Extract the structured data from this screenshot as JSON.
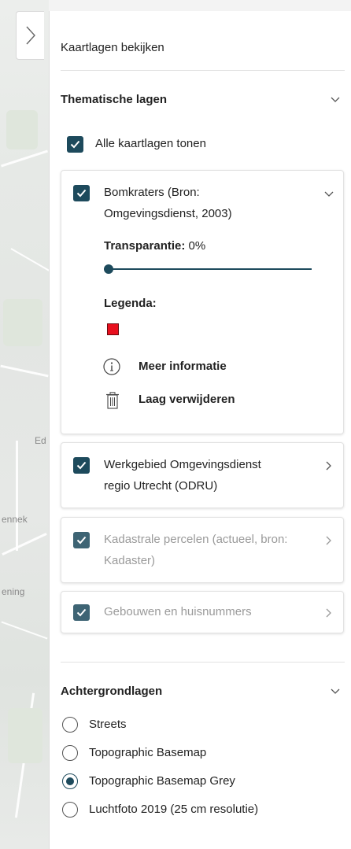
{
  "panel": {
    "title": "Kaartlagen bekijken",
    "toggle_icon": "chevron-right-icon"
  },
  "map_labels": [
    "Ed",
    "ennek",
    "ening"
  ],
  "thematic": {
    "title": "Thematische lagen",
    "show_all_label": "Alle kaartlagen tonen",
    "layers": [
      {
        "label_line1": "Bomkraters (Bron:",
        "label_line2": "Omgevingsdienst, 2003)",
        "expanded": true,
        "transparency_label": "Transparantie:",
        "transparency_value": "0%",
        "transparency_fraction": 0.0,
        "legend_label": "Legenda:",
        "legend_color": "#e8101e",
        "more_info_label": "Meer informatie",
        "remove_label": "Laag verwijderen"
      },
      {
        "label_line1": "Werkgebied Omgevingsdienst",
        "label_line2": "regio Utrecht (ODRU)",
        "expanded": false
      },
      {
        "label_line1": "Kadastrale percelen (actueel, bron:",
        "label_line2": "Kadaster)",
        "expanded": false,
        "muted": true
      },
      {
        "label_line1": "Gebouwen en huisnummers",
        "expanded": false,
        "muted": true
      }
    ]
  },
  "basemaps": {
    "title": "Achtergrondlagen",
    "options": [
      "Streets",
      "Topographic Basemap",
      "Topographic Basemap Grey",
      "Luchtfoto 2019 (25 cm resolutie)"
    ],
    "selected": "Topographic Basemap Grey"
  },
  "colors": {
    "accent": "#1d4a5c",
    "muted_text": "#9a9a9a"
  }
}
